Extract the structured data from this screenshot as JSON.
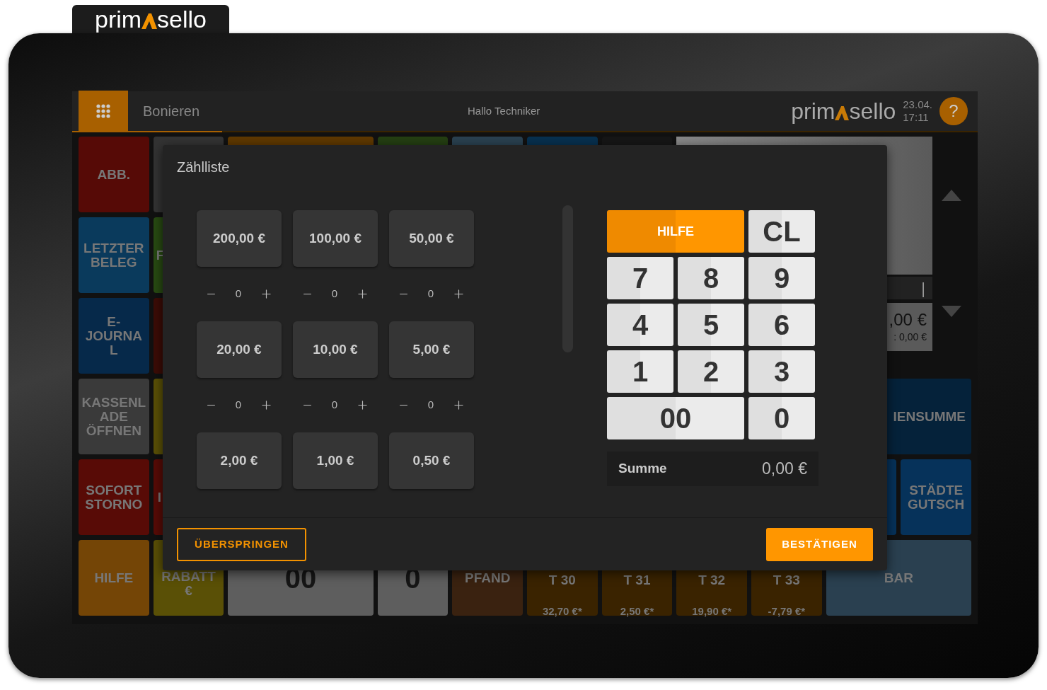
{
  "brand_tab": {
    "logo_left": "prim",
    "logo_right": "sello"
  },
  "header": {
    "title": "Bonieren",
    "greeting": "Hallo Techniker",
    "logo_left": "prim",
    "logo_right": "sello",
    "date": "23.04.",
    "time": "17:11",
    "help": "?"
  },
  "tiles": [
    {
      "kind": "tile",
      "label": "ABB.",
      "color": "#560a06"
    },
    {
      "kind": "tile",
      "color": "#333333"
    },
    {
      "kind": "tile",
      "color": "#5e3800"
    },
    {
      "kind": "tile",
      "color": "#243f12"
    },
    {
      "kind": "tile",
      "color": "#2a4150"
    },
    {
      "kind": "tile",
      "color": "#07304f"
    },
    {
      "kind": "tile",
      "color": "#161616"
    },
    {
      "kind": "tile",
      "label": "LETZTER BELEG",
      "color": "#0a3a5c"
    },
    {
      "kind": "tile",
      "label": "F",
      "color": "#284a12"
    },
    {
      "kind": "tile",
      "label": "E-JOURNAL",
      "color": "#06294a"
    },
    {
      "kind": "tile",
      "color": "#3c0c06"
    },
    {
      "kind": "tile",
      "label": "KASSENLADE ÖFFNEN",
      "color": "#3a3a3a"
    },
    {
      "kind": "tile",
      "color": "#5a5006"
    },
    {
      "kind": "tile",
      "label": "IENSUMME",
      "color": "#05223a"
    },
    {
      "kind": "tile",
      "label": "SOFORT STORNO",
      "color": "#580b06"
    },
    {
      "kind": "tile",
      "label": "I",
      "color": "#580b06"
    },
    {
      "kind": "tile",
      "color": "#06325a"
    },
    {
      "kind": "tile",
      "label": "STÄDTE GUTSCH",
      "color": "#06325a"
    },
    {
      "kind": "tile",
      "label": "HILFE",
      "color": "#744506"
    },
    {
      "kind": "tile",
      "label": "RABATT €",
      "color": "#5a5006"
    },
    {
      "kind": "key",
      "label": "00",
      "color": "#5e5e5e"
    },
    {
      "kind": "key",
      "label": "0",
      "color": "#5e5e5e"
    },
    {
      "kind": "tile",
      "label": "PFAND",
      "color": "#3a2210"
    },
    {
      "kind": "tile",
      "label": "T 30",
      "sublabel": "32,70 €*",
      "color": "#3a2300"
    },
    {
      "kind": "tile",
      "label": "T 31",
      "sublabel": "2,50 €*",
      "color": "#3a2300"
    },
    {
      "kind": "tile",
      "label": "T 32",
      "sublabel": "19,90 €*",
      "color": "#3a2300"
    },
    {
      "kind": "tile",
      "label": "T 33",
      "sublabel": "-7,79 €*",
      "color": "#3a2300"
    },
    {
      "kind": "tile",
      "label": "BAR",
      "color": "#2a4050"
    }
  ],
  "receipt": {
    "cursor": "|",
    "total": ",00 €",
    "subtotal": ": 0,00 €"
  },
  "dialog": {
    "title": "Zählliste",
    "denominations": [
      {
        "value": "200,00 €",
        "count": "0"
      },
      {
        "value": "100,00 €",
        "count": "0"
      },
      {
        "value": "50,00 €",
        "count": "0"
      },
      {
        "value": "20,00 €",
        "count": "0"
      },
      {
        "value": "10,00 €",
        "count": "0"
      },
      {
        "value": "5,00 €",
        "count": "0"
      },
      {
        "value": "2,00 €"
      },
      {
        "value": "1,00 €"
      },
      {
        "value": "0,50 €"
      }
    ],
    "keypad": [
      {
        "kind": "accent",
        "label": "HILFE"
      },
      {
        "kind": "digit",
        "label": "CL"
      },
      {
        "kind": "digit",
        "label": "7"
      },
      {
        "kind": "digit",
        "label": "8"
      },
      {
        "kind": "digit",
        "label": "9"
      },
      {
        "kind": "digit",
        "label": "4"
      },
      {
        "kind": "digit",
        "label": "5"
      },
      {
        "kind": "digit",
        "label": "6"
      },
      {
        "kind": "digit",
        "label": "1"
      },
      {
        "kind": "digit",
        "label": "2"
      },
      {
        "kind": "digit",
        "label": "3"
      },
      {
        "kind": "wide_digit",
        "label": "00"
      },
      {
        "kind": "digit",
        "label": "0"
      }
    ],
    "sum_label": "Summe",
    "sum_value": "0,00 €",
    "buttons": [
      {
        "kind": "secondary",
        "label": "ÜBERSPRINGEN"
      },
      {
        "kind": "primary",
        "label": "BESTÄTIGEN"
      }
    ]
  }
}
